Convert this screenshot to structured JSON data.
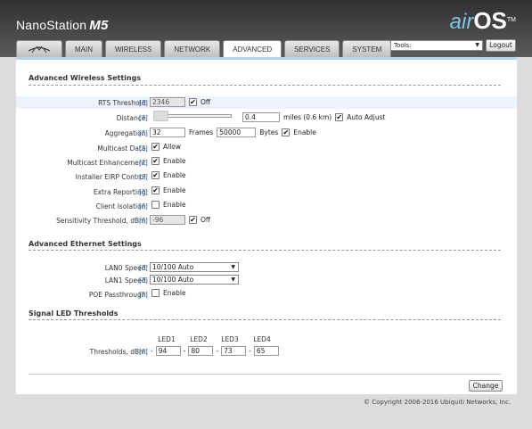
{
  "header": {
    "brand": "NanoStation",
    "model": "M5",
    "logo_air": "air",
    "logo_os": "OS",
    "logo_tm": "TM"
  },
  "tabs": [
    {
      "label": "",
      "icon": "ubiquiti-logo-icon"
    },
    {
      "label": "MAIN"
    },
    {
      "label": "WIRELESS"
    },
    {
      "label": "NETWORK"
    },
    {
      "label": "ADVANCED",
      "active": true
    },
    {
      "label": "SERVICES"
    },
    {
      "label": "SYSTEM"
    }
  ],
  "tools": {
    "selected": "Tools:"
  },
  "logout_label": "Logout",
  "help_label": "[?]",
  "wireless": {
    "title": "Advanced Wireless Settings",
    "rts": {
      "label": "RTS Threshold:",
      "value": "2346",
      "toggle_label": "Off",
      "toggle_checked": true
    },
    "distance": {
      "label": "Distance:",
      "value": "0.4",
      "unit": "miles (0.6 km)",
      "auto_label": "Auto Adjust",
      "auto_checked": true
    },
    "aggregation": {
      "label": "Aggregation:",
      "frames_value": "32",
      "frames_label": "Frames",
      "bytes_value": "50000",
      "bytes_label": "Bytes",
      "enable_label": "Enable",
      "enable_checked": true
    },
    "multicast_data": {
      "label": "Multicast Data:",
      "option_label": "Allow",
      "checked": true
    },
    "multicast_enh": {
      "label": "Multicast Enhancement:",
      "option_label": "Enable",
      "checked": true
    },
    "installer_eirp": {
      "label": "Installer EIRP Control:",
      "option_label": "Enable",
      "checked": true
    },
    "extra_reporting": {
      "label": "Extra Reporting:",
      "option_label": "Enable",
      "checked": true
    },
    "client_isolation": {
      "label": "Client Isolation:",
      "option_label": "Enable",
      "checked": false
    },
    "sensitivity": {
      "label": "Sensitivity Threshold, dBm:",
      "value": "-96",
      "toggle_label": "Off",
      "toggle_checked": true
    }
  },
  "ethernet": {
    "title": "Advanced Ethernet Settings",
    "lan0": {
      "label": "LAN0 Speed:",
      "value": "10/100 Auto"
    },
    "lan1": {
      "label": "LAN1 Speed:",
      "value": "10/100 Auto"
    },
    "poe": {
      "label": "POE Passthrough:",
      "option_label": "Enable",
      "checked": false
    }
  },
  "led": {
    "title": "Signal LED Thresholds",
    "headers": [
      "LED1",
      "LED2",
      "LED3",
      "LED4"
    ],
    "label": "Thresholds, dBm:",
    "sep": "-",
    "values": [
      "94",
      "80",
      "73",
      "65"
    ]
  },
  "change_label": "Change",
  "copyright": "© Copyright 2006-2016 Ubiquiti Networks, Inc."
}
